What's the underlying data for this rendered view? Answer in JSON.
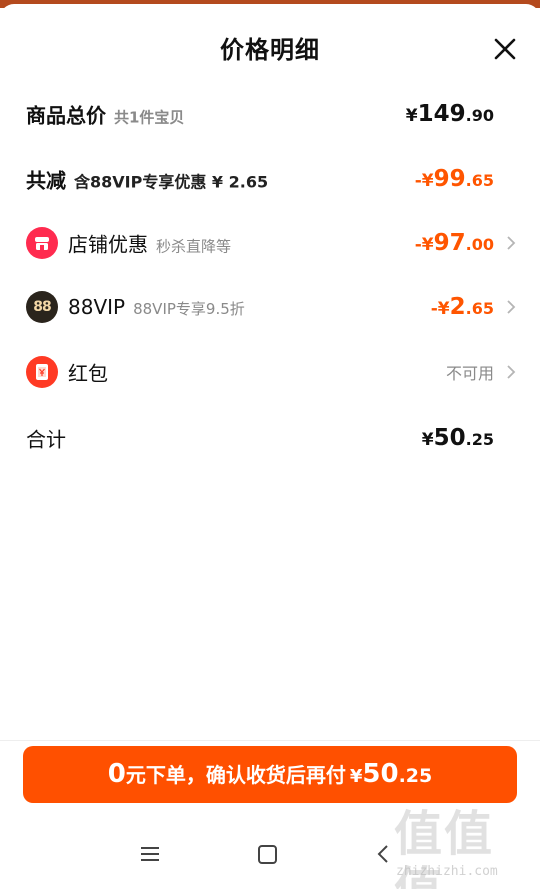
{
  "header": {
    "title": "价格明细"
  },
  "rows": {
    "total": {
      "label": "商品总价",
      "sub": "共1件宝贝",
      "cur": "¥",
      "int": "149",
      "dec": ".90"
    },
    "reduce": {
      "label": "共减",
      "sub": "含88VIP专享优惠 ¥ 2.65",
      "cur": "-¥",
      "int": "99",
      "dec": ".65"
    },
    "shop": {
      "label": "店铺优惠",
      "sub": "秒杀直降等",
      "cur": "-¥",
      "int": "97",
      "dec": ".00"
    },
    "vip": {
      "label": "88VIP",
      "sub": "88VIP专享9.5折",
      "icon_text": "88",
      "cur": "-¥",
      "int": "2",
      "dec": ".65"
    },
    "redpacket": {
      "label": "红包",
      "status": "不可用"
    },
    "sum": {
      "label": "合计",
      "cur": "¥",
      "int": "50",
      "dec": ".25"
    }
  },
  "cta": {
    "zero": "0",
    "text": "元下单，确认收货后再付",
    "cur": "¥",
    "int": "50",
    "dec": ".25"
  },
  "watermark": {
    "glyphs": "值值值",
    "url": "zhizhizhi.com"
  },
  "colors": {
    "accent": "#ff5000",
    "shop_icon": "#ff2b4f",
    "vip_icon": "#2a241c",
    "redpacket_icon": "#ff3a24"
  },
  "icons": [
    "close-icon",
    "shop-icon",
    "vip-88-icon",
    "red-packet-icon",
    "chevron-right-icon",
    "menu-icon",
    "home-icon",
    "back-icon"
  ]
}
